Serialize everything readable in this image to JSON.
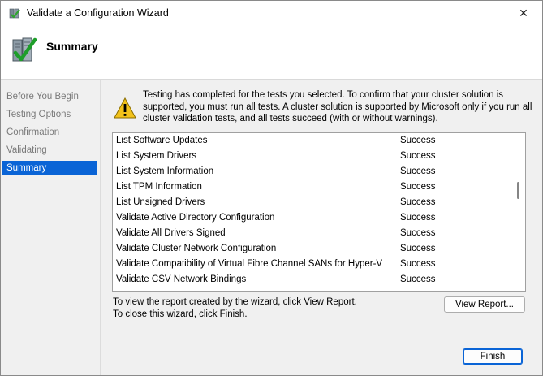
{
  "window": {
    "title": "Validate a Configuration Wizard",
    "close_glyph": "✕"
  },
  "header": {
    "title": "Summary",
    "icon": "server-checkmark-icon"
  },
  "nav": {
    "items": [
      {
        "label": "Before You Begin",
        "selected": false
      },
      {
        "label": "Testing Options",
        "selected": false
      },
      {
        "label": "Confirmation",
        "selected": false
      },
      {
        "label": "Validating",
        "selected": false
      },
      {
        "label": "Summary",
        "selected": true
      }
    ]
  },
  "main": {
    "message": "Testing has completed for the tests you selected. To confirm that your cluster solution is supported, you must run all tests.  A cluster solution is supported by Microsoft only if you run all cluster validation tests, and all tests succeed (with or without warnings).",
    "results": [
      {
        "name": "List Software Updates",
        "status": "Success"
      },
      {
        "name": "List System Drivers",
        "status": "Success"
      },
      {
        "name": "List System Information",
        "status": "Success"
      },
      {
        "name": "List TPM Information",
        "status": "Success"
      },
      {
        "name": "List Unsigned Drivers",
        "status": "Success"
      },
      {
        "name": "Validate Active Directory Configuration",
        "status": "Success"
      },
      {
        "name": "Validate All Drivers Signed",
        "status": "Success"
      },
      {
        "name": "Validate Cluster Network Configuration",
        "status": "Success"
      },
      {
        "name": "Validate Compatibility of Virtual Fibre Channel SANs for Hyper-V",
        "status": "Success"
      },
      {
        "name": "Validate CSV Network Bindings",
        "status": "Success"
      }
    ],
    "report_note": "To view the report created by the wizard, click View Report.",
    "close_note": "To close this wizard, click Finish.",
    "view_report_label": "View Report...",
    "finish_label": "Finish"
  },
  "colors": {
    "accent": "#0a64d6",
    "warning": "#f2c21b"
  }
}
